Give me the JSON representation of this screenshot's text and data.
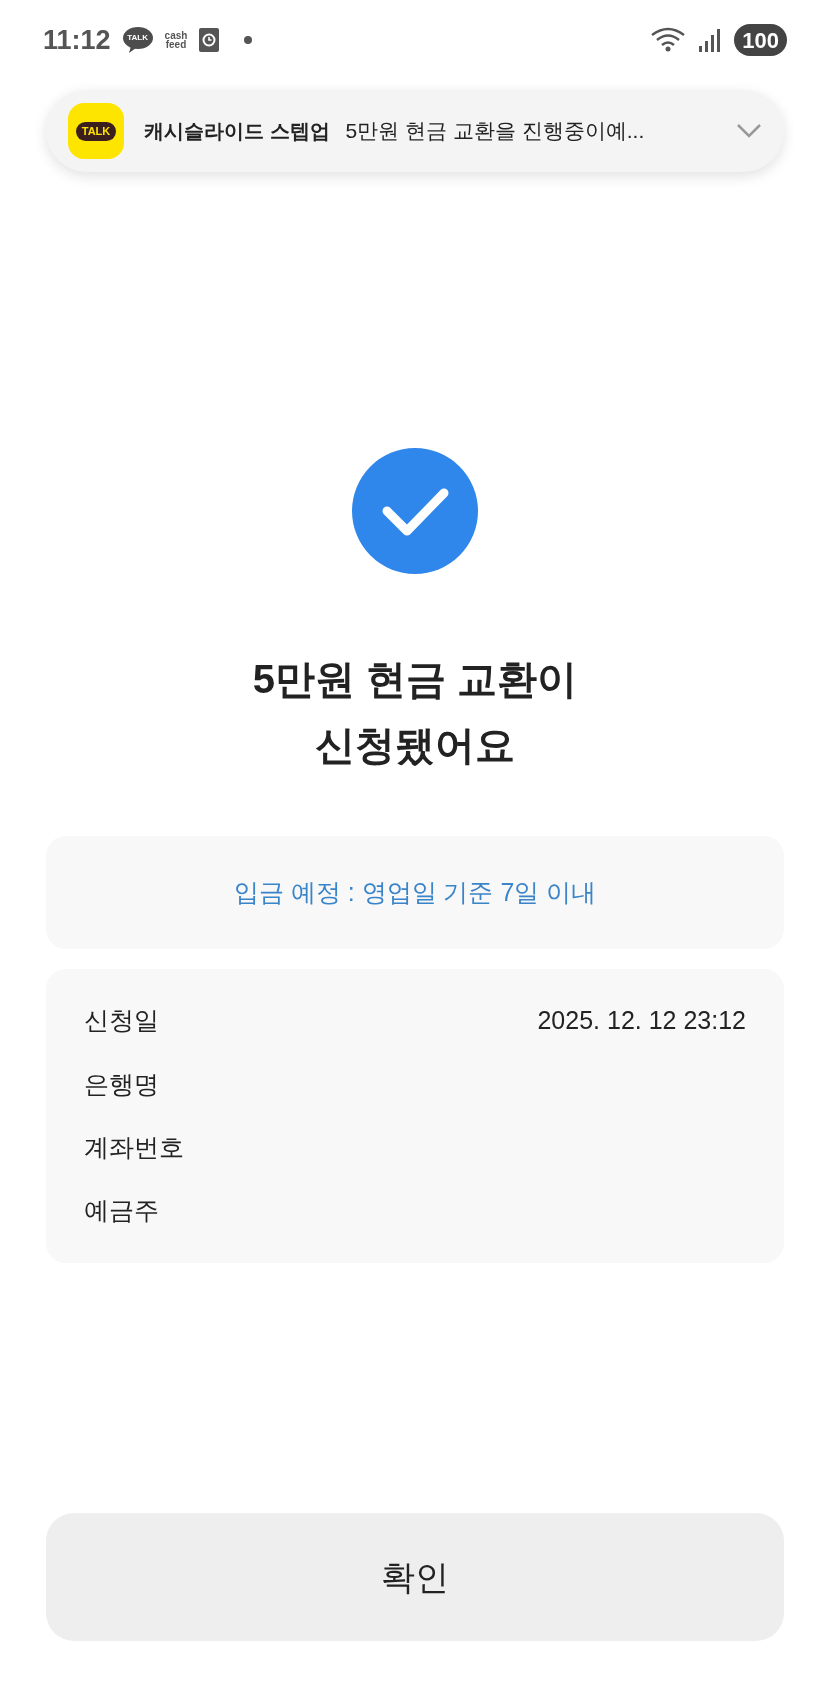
{
  "status_bar": {
    "time": "11:12",
    "app_icons": [
      {
        "kind": "talk",
        "label": "TALK"
      },
      {
        "kind": "cashfeed",
        "label": "cash",
        "label2": "feed"
      },
      {
        "kind": "clock"
      },
      {
        "kind": "dot"
      }
    ],
    "battery": "100"
  },
  "notification": {
    "app_icon": "TALK",
    "app": "캐시슬라이드 스텝업",
    "message": "5만원 현금 교환을 진행중이예...",
    "expanded": false
  },
  "result": {
    "title_lines": [
      "5만원 현금 교환이",
      "신청됐어요"
    ]
  },
  "notice": "입금 예정 : 영업일 기준 7일 이내",
  "details": [
    {
      "label": "신청일",
      "value": "2025. 12. 12 23:12"
    },
    {
      "label": "은행명"
    },
    {
      "label": "계좌번호"
    },
    {
      "label": "예금주"
    }
  ],
  "confirm_button": "확인"
}
